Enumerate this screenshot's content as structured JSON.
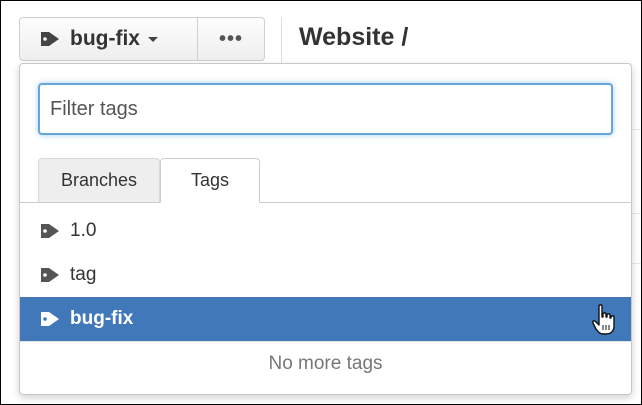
{
  "ref_selector": {
    "current": "bug-fix",
    "icon": "tag-icon"
  },
  "more_button": {
    "label": "•••"
  },
  "breadcrumb": {
    "repo": "Website /"
  },
  "filter": {
    "placeholder": "Filter tags",
    "value": ""
  },
  "tabs": [
    {
      "label": "Branches",
      "active": false
    },
    {
      "label": "Tags",
      "active": true
    }
  ],
  "tags": [
    {
      "label": "1.0",
      "selected": false
    },
    {
      "label": "tag",
      "selected": false
    },
    {
      "label": "bug-fix",
      "selected": true
    }
  ],
  "footer": {
    "no_more": "No more tags"
  },
  "colors": {
    "selected_bg": "#4078b9",
    "focus_border": "#66a6dc"
  }
}
